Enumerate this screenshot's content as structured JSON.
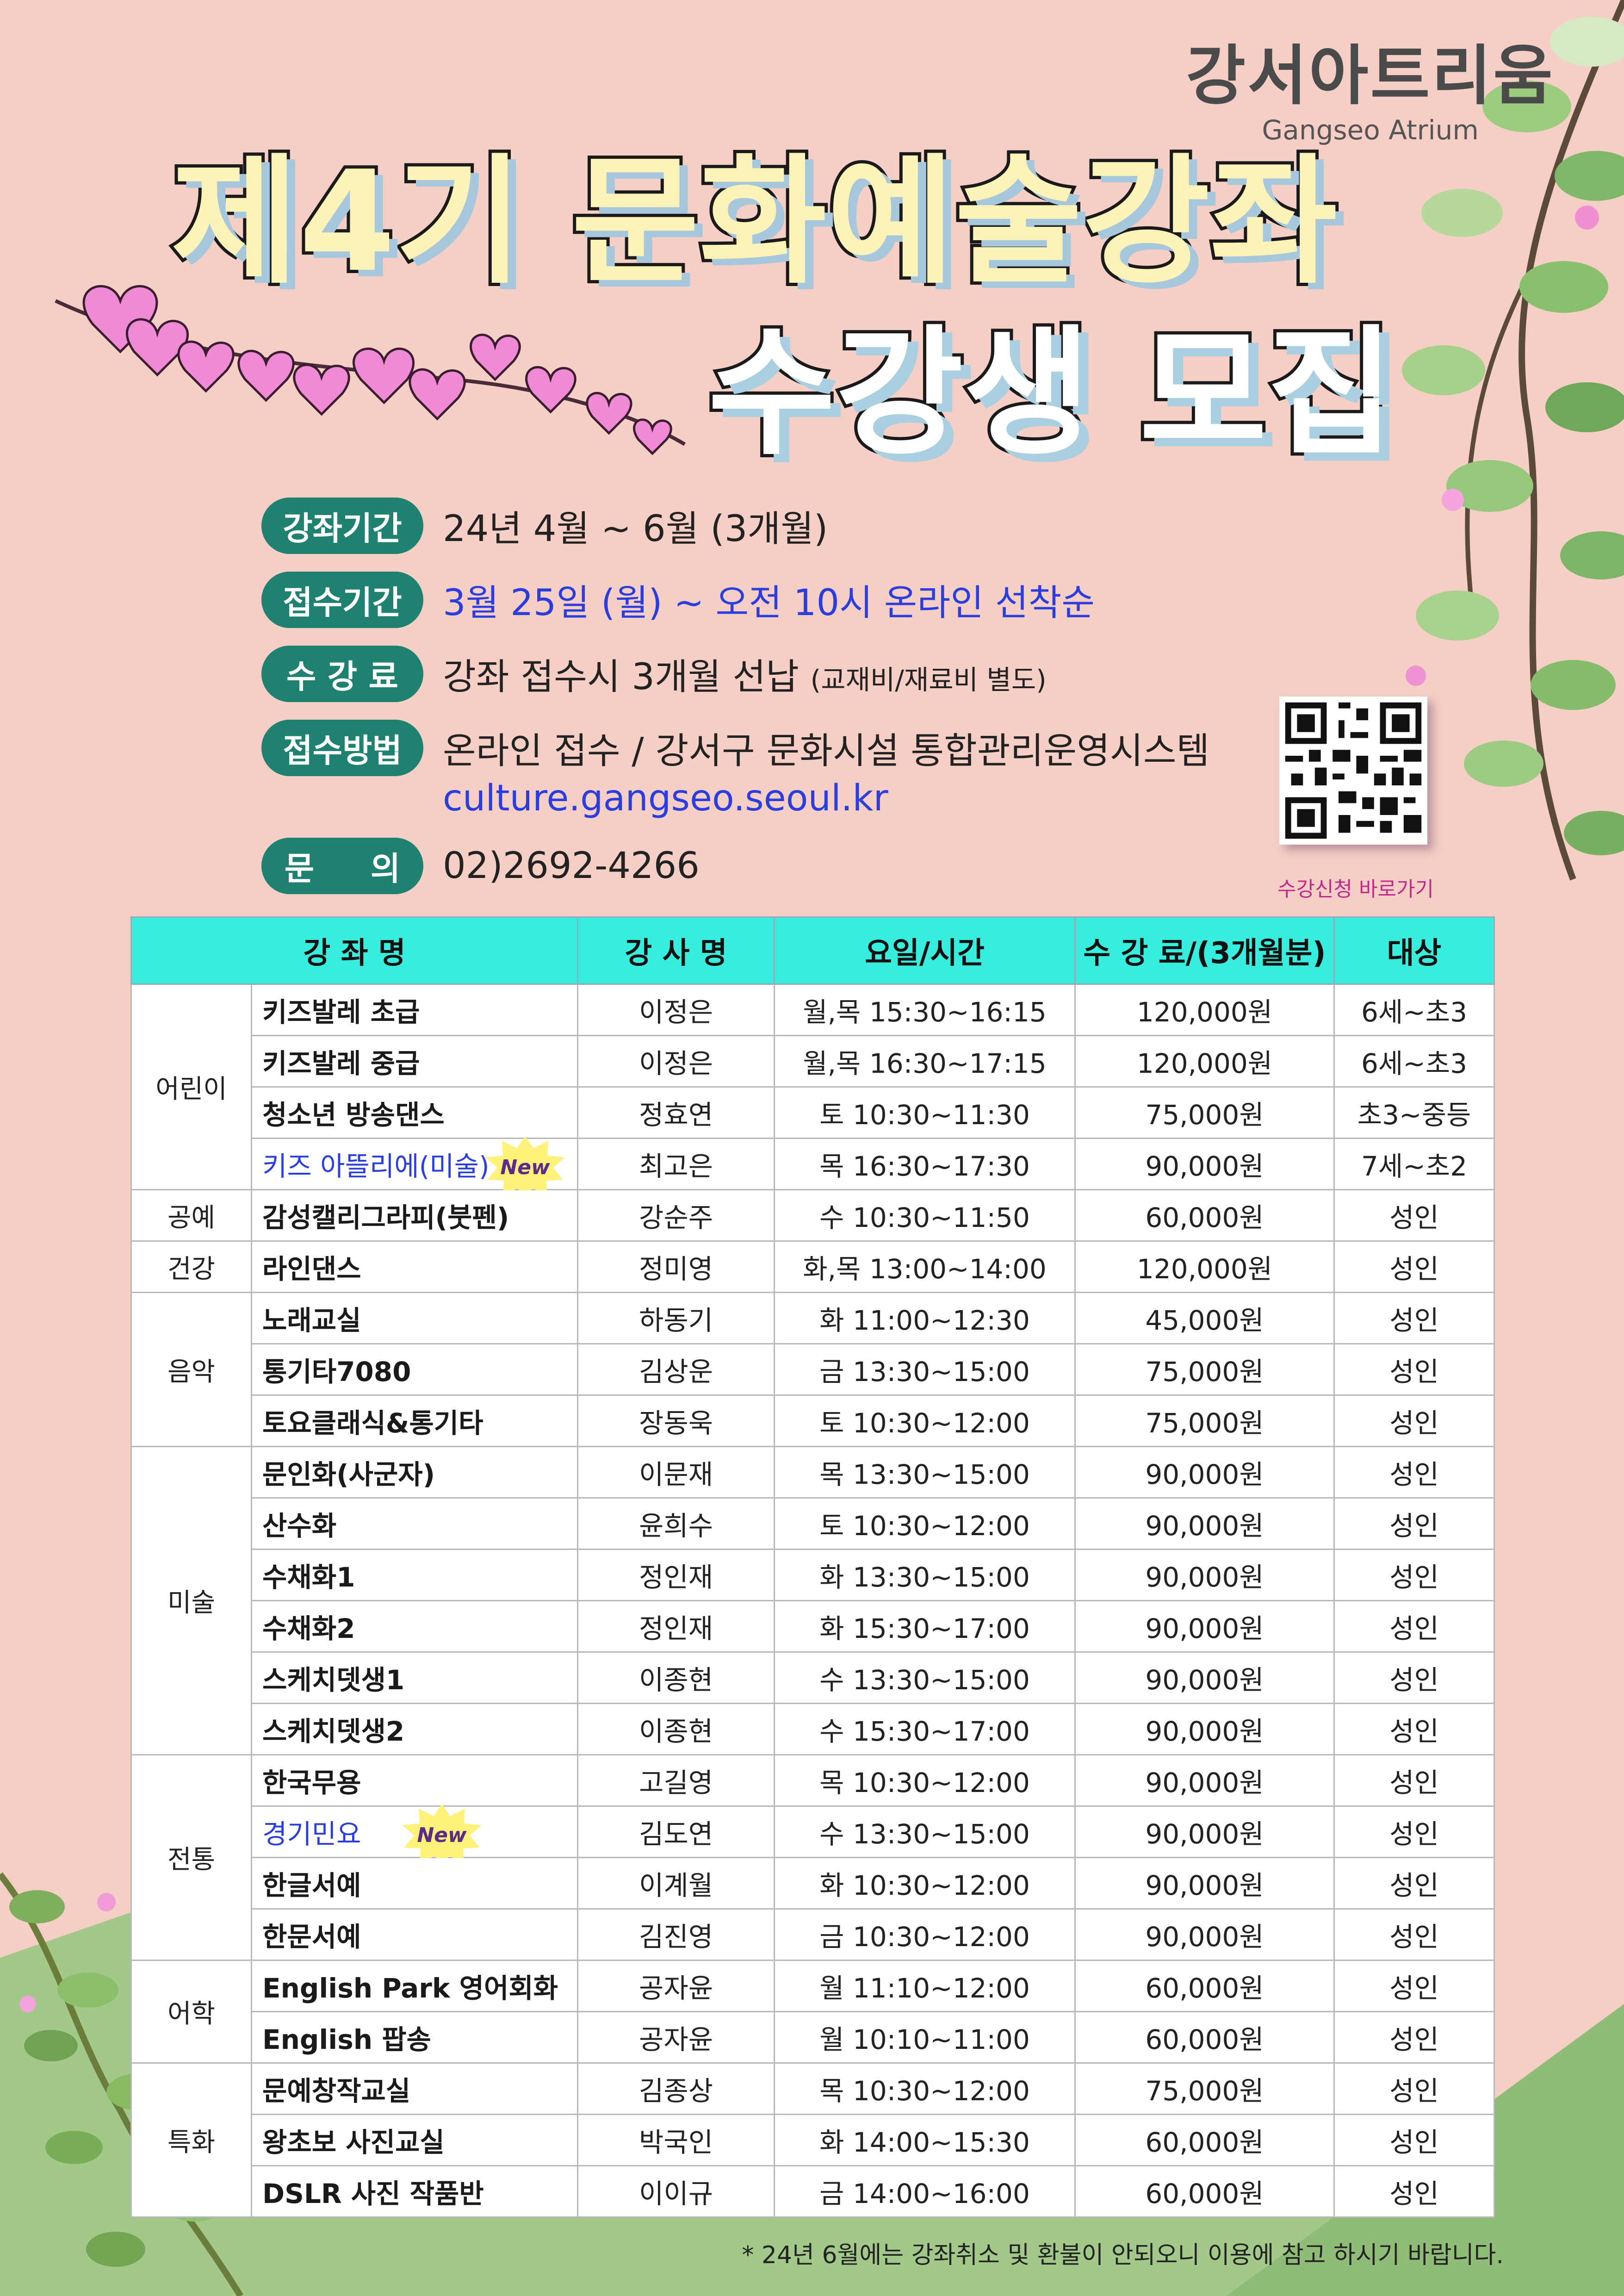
{
  "logo": {
    "ko": "강서아트리움",
    "en": "Gangseo Atrium"
  },
  "title": {
    "line1": "제4기 문화예술강좌",
    "line2": "수강생 모집"
  },
  "info": [
    {
      "label": "강좌기간",
      "text": "24년 4월 ~ 6월 (3개월)",
      "small": ""
    },
    {
      "label": "접수기간",
      "text": "3월 25일 (월) ~ 오전 10시  온라인 선착순",
      "small": ""
    },
    {
      "label": "수 강 료",
      "text": "강좌 접수시 3개월 선납 ",
      "small": "(교재비/재료비 별도)"
    },
    {
      "label": "접수방법",
      "text": "온라인 접수 / 강서구 문화시설 통합관리운영시스템",
      "small": ""
    },
    {
      "label": "문     의",
      "text": "02)2692-4266",
      "small": ""
    }
  ],
  "url": "culture.gangseo.seoul.kr",
  "qr_caption": "수강신청 바로가기",
  "badge_text": "New",
  "table": {
    "headers": [
      "강 좌 명",
      "강 사 명",
      "요일/시간",
      "수 강 료/(3개월분)",
      "대상"
    ],
    "categories": [
      "어린이",
      "공예",
      "건강",
      "음악",
      "미술",
      "전통",
      "어학",
      "특화"
    ],
    "rows": [
      {
        "course": "키즈발레 초급",
        "teacher": "이정은",
        "time": "월,목 15:30~16:15",
        "fee": "120,000원",
        "target": "6세~초3"
      },
      {
        "course": "키즈발레 중급",
        "teacher": "이정은",
        "time": "월,목 16:30~17:15",
        "fee": "120,000원",
        "target": "6세~초3"
      },
      {
        "course": "청소년 방송댄스",
        "teacher": "정효연",
        "time": "토 10:30~11:30",
        "fee": "75,000원",
        "target": "초3~중등"
      },
      {
        "course": "키즈 아뜰리에(미술)",
        "teacher": "최고은",
        "time": "목 16:30~17:30",
        "fee": "90,000원",
        "target": "7세~초2"
      },
      {
        "course": "감성캘리그라피(붓펜)",
        "teacher": "강순주",
        "time": "수 10:30~11:50",
        "fee": "60,000원",
        "target": "성인"
      },
      {
        "course": "라인댄스",
        "teacher": "정미영",
        "time": "화,목 13:00~14:00",
        "fee": "120,000원",
        "target": "성인"
      },
      {
        "course": "노래교실",
        "teacher": "하동기",
        "time": "화 11:00~12:30",
        "fee": "45,000원",
        "target": "성인"
      },
      {
        "course": "통기타7080",
        "teacher": "김상운",
        "time": "금 13:30~15:00",
        "fee": "75,000원",
        "target": "성인"
      },
      {
        "course": "토요클래식&통기타",
        "teacher": "장동욱",
        "time": "토 10:30~12:00",
        "fee": "75,000원",
        "target": "성인"
      },
      {
        "course": "문인화(사군자)",
        "teacher": "이문재",
        "time": "목 13:30~15:00",
        "fee": "90,000원",
        "target": "성인"
      },
      {
        "course": "산수화",
        "teacher": "윤희수",
        "time": "토 10:30~12:00",
        "fee": "90,000원",
        "target": "성인"
      },
      {
        "course": "수채화1",
        "teacher": "정인재",
        "time": "화 13:30~15:00",
        "fee": "90,000원",
        "target": "성인"
      },
      {
        "course": "수채화2",
        "teacher": "정인재",
        "time": "화 15:30~17:00",
        "fee": "90,000원",
        "target": "성인"
      },
      {
        "course": "스케치뎃생1",
        "teacher": "이종현",
        "time": "수 13:30~15:00",
        "fee": "90,000원",
        "target": "성인"
      },
      {
        "course": "스케치뎃생2",
        "teacher": "이종현",
        "time": "수 15:30~17:00",
        "fee": "90,000원",
        "target": "성인"
      },
      {
        "course": "한국무용",
        "teacher": "고길영",
        "time": "목 10:30~12:00",
        "fee": "90,000원",
        "target": "성인"
      },
      {
        "course": "경기민요",
        "teacher": "김도연",
        "time": "수 13:30~15:00",
        "fee": "90,000원",
        "target": "성인"
      },
      {
        "course": "한글서예",
        "teacher": "이계월",
        "time": "화 10:30~12:00",
        "fee": "90,000원",
        "target": "성인"
      },
      {
        "course": "한문서예",
        "teacher": "김진영",
        "time": "금 10:30~12:00",
        "fee": "90,000원",
        "target": "성인"
      },
      {
        "course": "English Park 영어회화",
        "teacher": "공자윤",
        "time": "월 11:10~12:00",
        "fee": "60,000원",
        "target": "성인"
      },
      {
        "course": "English 팝송",
        "teacher": "공자윤",
        "time": "월 10:10~11:00",
        "fee": "60,000원",
        "target": "성인"
      },
      {
        "course": "문예창작교실",
        "teacher": "김종상",
        "time": "목 10:30~12:00",
        "fee": "75,000원",
        "target": "성인"
      },
      {
        "course": "왕초보 사진교실",
        "teacher": "박국인",
        "time": "화 14:00~15:30",
        "fee": "60,000원",
        "target": "성인"
      },
      {
        "course": "DSLR 사진 작품반",
        "teacher": "이이규",
        "time": "금 14:00~16:00",
        "fee": "60,000원",
        "target": "성인"
      }
    ]
  },
  "footnote": "* 24년 6월에는 강좌취소 및 환불이 안되오니 이용에 참고 하시기 바랍니다.",
  "colors": {
    "background": "#f5cfc5",
    "pill": "#1f8270",
    "header": "#37eddd",
    "highlight": "#2a3ee0",
    "hill": "#9fc585"
  }
}
